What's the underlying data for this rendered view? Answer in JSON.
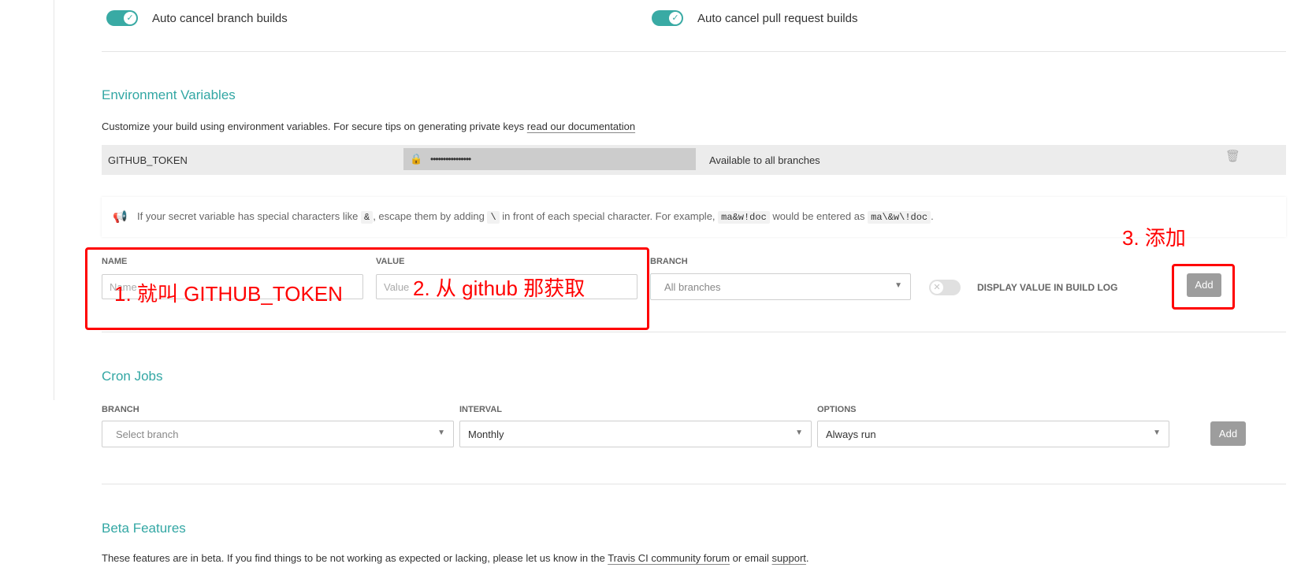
{
  "general": {
    "auto_cancel_branch": {
      "label": "Auto cancel branch builds",
      "on": true
    },
    "auto_cancel_pr": {
      "label": "Auto cancel pull request builds",
      "on": true
    }
  },
  "env_vars": {
    "title": "Environment Variables",
    "description": "Customize your build using environment variables. For secure tips on generating private keys",
    "description_link": "read our documentation",
    "existing": {
      "name": "GITHUB_TOKEN",
      "value_masked": "••••••••••••••••",
      "branch": "Available to all branches"
    },
    "note": {
      "t1": "If your secret variable has special characters like",
      "c1": "&",
      "t2": ", escape them by adding",
      "c2": "\\",
      "t3": "in front of each special character. For example,",
      "c3": "ma&w!doc",
      "t4": "would be entered as",
      "c4": "ma\\&w\\!doc",
      "t5": "."
    },
    "form": {
      "name_label": "NAME",
      "name_placeholder": "Name",
      "value_label": "VALUE",
      "value_placeholder": "Value",
      "branch_label": "BRANCH",
      "branch_value": "All branches",
      "display_label": "DISPLAY VALUE IN BUILD LOG",
      "display_on": false,
      "add_label": "Add"
    }
  },
  "cron": {
    "title": "Cron Jobs",
    "branch_label": "BRANCH",
    "branch_value": "Select branch",
    "interval_label": "INTERVAL",
    "interval_value": "Monthly",
    "options_label": "OPTIONS",
    "options_value": "Always run",
    "add_label": "Add"
  },
  "beta": {
    "title": "Beta Features",
    "t1": "These features are in beta. If you find things to be not working as expected or lacking, please let us know in the",
    "link1": "Travis CI community forum",
    "t2": "or email",
    "link2": "support",
    "t3": "."
  },
  "annotations": {
    "a1": "1. 就叫 GITHUB_TOKEN",
    "a2": "2. 从 github 那获取",
    "a3": "3. 添加"
  },
  "colors": {
    "accent": "#33a7a4",
    "toggle_on": "#39aaa4",
    "annotation": "#ff0000",
    "button": "#9d9d9d"
  }
}
